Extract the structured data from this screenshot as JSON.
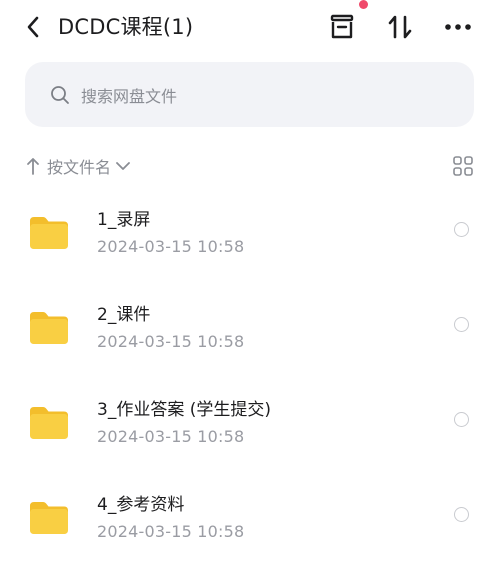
{
  "header": {
    "title": "DCDC课程(1)",
    "icons": [
      "back-icon",
      "archive-icon",
      "sort-arrows-icon",
      "more-icon"
    ],
    "accent_dot_color": "#f04a6b"
  },
  "search": {
    "placeholder": "搜索网盘文件"
  },
  "sort": {
    "label": "按文件名",
    "direction": "ascending"
  },
  "files": [
    {
      "name": "1_录屏",
      "date": "2024-03-15  10:58"
    },
    {
      "name": "2_课件",
      "date": "2024-03-15  10:58"
    },
    {
      "name": "3_作业答案 (学生提交)",
      "date": "2024-03-15  10:58"
    },
    {
      "name": "4_参考资料",
      "date": "2024-03-15  10:58"
    }
  ],
  "colors": {
    "folder": "#f9cf43",
    "folder_tab": "#f3be2c",
    "search_bg": "#f2f3f7",
    "muted_text": "#8a8d94"
  }
}
